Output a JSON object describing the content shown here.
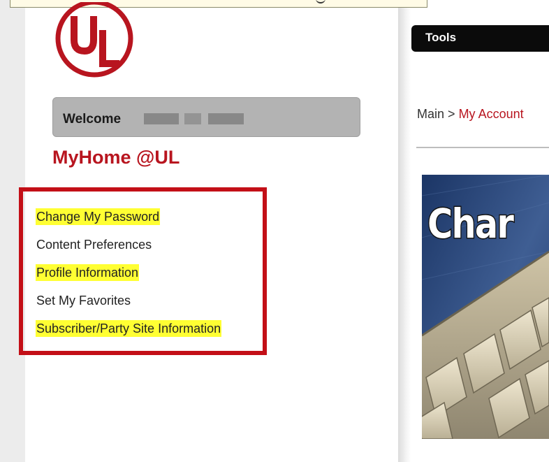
{
  "brand": {
    "logo_text": "UL",
    "accent_color": "#b8151f"
  },
  "sidebar": {
    "welcome_label": "Welcome",
    "user_name_redacted": true,
    "home_title": "MyHome @UL",
    "menu": [
      {
        "label": "Change My Password",
        "highlighted": true
      },
      {
        "label": "Content Preferences",
        "highlighted": false
      },
      {
        "label": "Profile Information",
        "highlighted": true
      },
      {
        "label": "Set My Favorites",
        "highlighted": false
      },
      {
        "label": "Subscriber/Party Site Information",
        "highlighted": true
      }
    ]
  },
  "toolbar": {
    "tools_label": "Tools"
  },
  "breadcrumb": {
    "main": "Main",
    "separator": ">",
    "current": "My Account"
  },
  "banner": {
    "title": "Char"
  }
}
